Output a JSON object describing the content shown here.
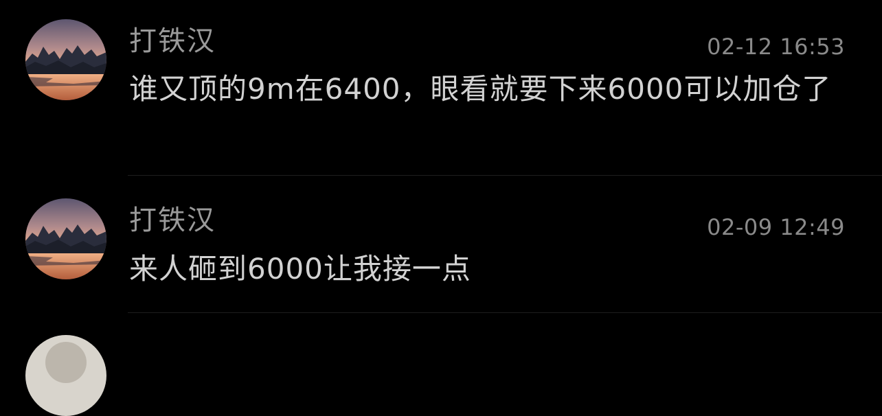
{
  "comments": [
    {
      "username": "打铁汉",
      "timestamp": "02-12 16:53",
      "text": "谁又顶的9m在6400，眼看就要下来6000可以加仓了"
    },
    {
      "username": "打铁汉",
      "timestamp": "02-09 12:49",
      "text": "来人砸到6000让我接一点"
    }
  ],
  "icons": {
    "avatar": "landscape-sunset-avatar-icon"
  }
}
